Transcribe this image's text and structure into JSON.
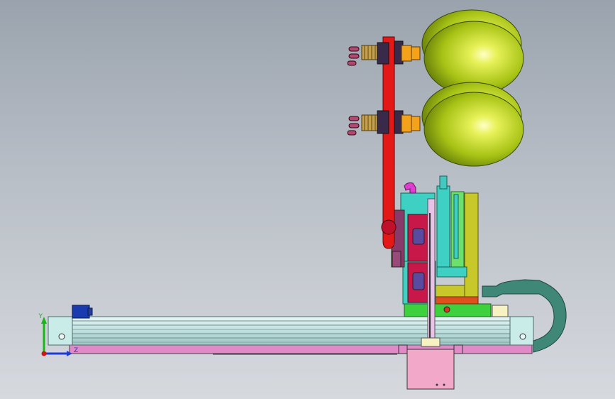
{
  "viewport": {
    "background_top": "#9aa3ad",
    "background_bottom": "#d6d9de"
  },
  "triad": {
    "y_label": "Y",
    "z_label": "Z",
    "x_color": "#1f3bd6",
    "y_color": "#16b816",
    "z_color": "#d01414"
  },
  "colors": {
    "rail": "#cfe7e5",
    "rail_edge": "#4e6b6a",
    "base_plate": "#e08ac8",
    "end_block": "#c9ece9",
    "motor": "#1a3ab0",
    "carriage_green": "#3ed13e",
    "column_teal": "#3fd0c4",
    "slide_yellow": "#c8c82a",
    "arm_red": "#e51818",
    "suction_cup": "#b4d21c",
    "fitting_orange": "#f3a21a",
    "spring": "#c6a04a",
    "cable_chain": "#3f8878",
    "pink_block": "#f2a8c8",
    "crimson_plate": "#c8184a",
    "magenta_fitting": "#e03cd2"
  }
}
